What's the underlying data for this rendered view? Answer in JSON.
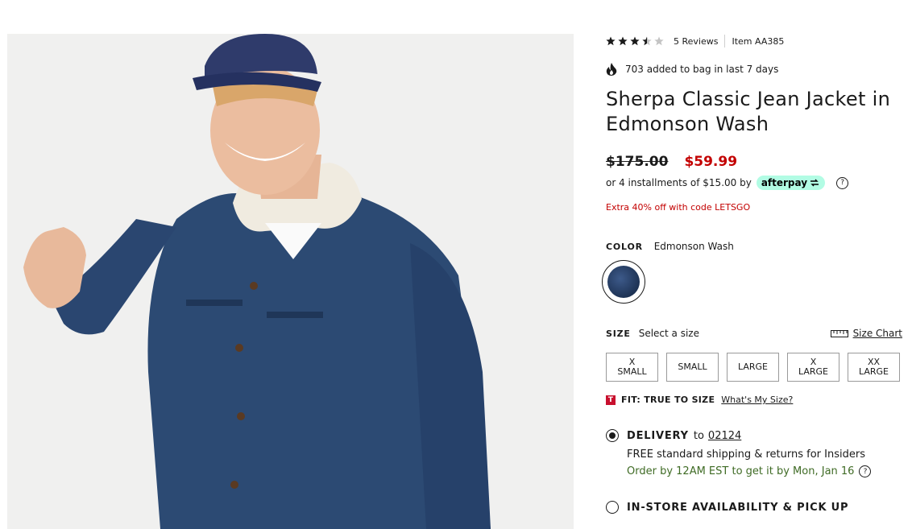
{
  "product": {
    "rating": 3.5,
    "rating_max": 5,
    "reviews_label": "5 Reviews",
    "item_label": "Item AA385",
    "social_proof": "703 added to bag in last 7 days",
    "title": "Sherpa Classic Jean Jacket in Edmonson Wash",
    "price_original": "$175.00",
    "price_sale": "$59.99",
    "installments_text": "or 4 installments of $15.00 by",
    "afterpay_label": "afterpay",
    "promo_text": "Extra 40% off with code LETSGO"
  },
  "color": {
    "label": "COLOR",
    "selected": "Edmonson Wash",
    "swatch_color": "#1e3355"
  },
  "size": {
    "label": "SIZE",
    "prompt": "Select a size",
    "chart_label": "Size Chart",
    "options": [
      "X\nSMALL",
      "SMALL",
      "LARGE",
      "X\nLARGE",
      "XX\nLARGE"
    ]
  },
  "fit": {
    "badge": "T",
    "text": "FIT: TRUE TO SIZE",
    "link": "What's My Size?"
  },
  "delivery": {
    "title": "DELIVERY",
    "to": "to",
    "zip": "02124",
    "shipping": "FREE standard shipping & returns for Insiders",
    "order_by": "Order by 12AM EST to get it by Mon, Jan 16",
    "selected": true
  },
  "instore": {
    "title": "IN-STORE AVAILABILITY & PICK UP",
    "selected": false
  },
  "colors": {
    "sale_red": "#c30000",
    "afterpay_mint": "#b2fce4",
    "order_green": "#3f6b25",
    "denim": "#2b4670"
  }
}
